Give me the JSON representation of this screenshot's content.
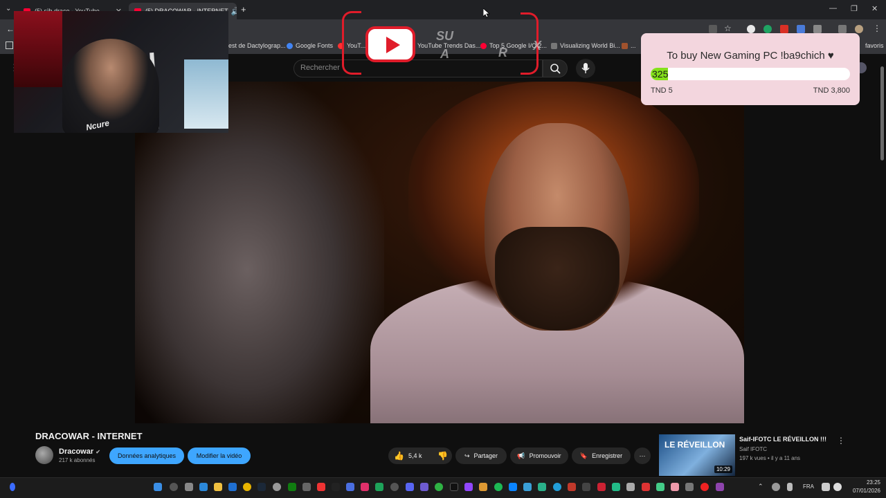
{
  "browser": {
    "tabs": [
      {
        "label": "(5) sïb draco - YouTube"
      },
      {
        "label": "(5) DRACOWAR - INTERNET"
      }
    ],
    "new_tab": "+",
    "bookmarks": [
      {
        "label": "est de Dactylograp..."
      },
      {
        "label": "Google Fonts"
      },
      {
        "label": "YouT..."
      },
      {
        "label": "YouTube Trends Das..."
      },
      {
        "label": "Top 5 Google I/O 2..."
      },
      {
        "label": "Visualizing World Bi..."
      },
      {
        "label": "..."
      }
    ],
    "bookmarks_right": "favoris"
  },
  "youtube": {
    "search_placeholder": "Rechercher",
    "video_title": "DRACOWAR - INTERNET",
    "channel_name": "Dracowar",
    "subscribers": "217 k abonnés",
    "analytics_label": "Données analytiques",
    "edit_label": "Modifier la vidéo",
    "likes": "5,4 k",
    "share_label": "Partager",
    "promote_label": "Promouvoir",
    "save_label": "Enregistrer",
    "more_label": "⋯",
    "suggested": {
      "thumb_text": "LE RÉVEILLON",
      "title": "Saif-IFOTC LE RÉVEILLON !!!",
      "channel": "Saif IFOTC",
      "meta": "197 k vues • il y a 11 ans",
      "duration": "10:29"
    }
  },
  "overlay": {
    "ghost_letters": [
      "SU",
      "A",
      "R",
      "X"
    ],
    "webcam_logo": "Ncure"
  },
  "donation_goal": {
    "title": "To buy New Gaming PC !ba9chich ♥",
    "current": "325",
    "min_label": "TND 5",
    "max_label": "TND 3,800",
    "progress_fraction": 0.0855,
    "fill_color": "#84e11b",
    "bg_color": "#f3d6de"
  },
  "taskbar": {
    "language": "FRA",
    "time": "23:25",
    "date": "07/01/2026"
  },
  "window": {
    "minimize": "—",
    "maximize": "❐",
    "close": "✕"
  },
  "colors": {
    "accent_blue": "#3ea6ff",
    "yt_red": "#e01c2a"
  }
}
